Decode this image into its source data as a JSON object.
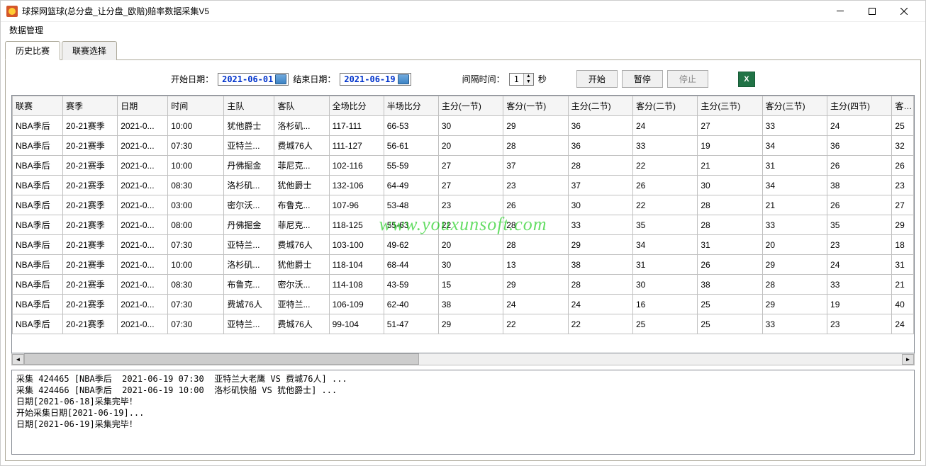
{
  "window": {
    "title": "球探网篮球(总分盘_让分盘_欧赔)赔率数据采集V5"
  },
  "menu": {
    "item1": "数据管理"
  },
  "tabs": {
    "history": "历史比赛",
    "league": "联赛选择"
  },
  "controls": {
    "start_date_label": "开始日期：",
    "start_date": "2021-06-01",
    "end_date_label": "结束日期：",
    "end_date": "2021-06-19",
    "interval_label": "间隔时间：",
    "interval_value": "1",
    "interval_unit": "秒",
    "btn_start": "开始",
    "btn_pause": "暂停",
    "btn_stop": "停止",
    "excel_icon": "X"
  },
  "table": {
    "headers": [
      "联赛",
      "赛季",
      "日期",
      "时间",
      "主队",
      "客队",
      "全场比分",
      "半场比分",
      "主分(一节)",
      "客分(一节)",
      "主分(二节)",
      "客分(二节)",
      "主分(三节)",
      "客分(三节)",
      "主分(四节)",
      "客分"
    ],
    "rows": [
      [
        "NBA季后",
        "20-21赛季",
        "2021-0...",
        "10:00",
        "犹他爵士",
        "洛杉矶...",
        "117-111",
        "66-53",
        "30",
        "29",
        "36",
        "24",
        "27",
        "33",
        "24",
        "25"
      ],
      [
        "NBA季后",
        "20-21赛季",
        "2021-0...",
        "07:30",
        "亚特兰...",
        "费城76人",
        "111-127",
        "56-61",
        "20",
        "28",
        "36",
        "33",
        "19",
        "34",
        "36",
        "32"
      ],
      [
        "NBA季后",
        "20-21赛季",
        "2021-0...",
        "10:00",
        "丹佛掘金",
        "菲尼克...",
        "102-116",
        "55-59",
        "27",
        "37",
        "28",
        "22",
        "21",
        "31",
        "26",
        "26"
      ],
      [
        "NBA季后",
        "20-21赛季",
        "2021-0...",
        "08:30",
        "洛杉矶...",
        "犹他爵士",
        "132-106",
        "64-49",
        "27",
        "23",
        "37",
        "26",
        "30",
        "34",
        "38",
        "23"
      ],
      [
        "NBA季后",
        "20-21赛季",
        "2021-0...",
        "03:00",
        "密尔沃...",
        "布鲁克...",
        "107-96",
        "53-48",
        "23",
        "26",
        "30",
        "22",
        "28",
        "21",
        "26",
        "27"
      ],
      [
        "NBA季后",
        "20-21赛季",
        "2021-0...",
        "08:00",
        "丹佛掘金",
        "菲尼克...",
        "118-125",
        "55-63",
        "22",
        "28",
        "33",
        "35",
        "28",
        "33",
        "35",
        "29"
      ],
      [
        "NBA季后",
        "20-21赛季",
        "2021-0...",
        "07:30",
        "亚特兰...",
        "费城76人",
        "103-100",
        "49-62",
        "20",
        "28",
        "29",
        "34",
        "31",
        "20",
        "23",
        "18"
      ],
      [
        "NBA季后",
        "20-21赛季",
        "2021-0...",
        "10:00",
        "洛杉矶...",
        "犹他爵士",
        "118-104",
        "68-44",
        "30",
        "13",
        "38",
        "31",
        "26",
        "29",
        "24",
        "31"
      ],
      [
        "NBA季后",
        "20-21赛季",
        "2021-0...",
        "08:30",
        "布鲁克...",
        "密尔沃...",
        "114-108",
        "43-59",
        "15",
        "29",
        "28",
        "30",
        "38",
        "28",
        "33",
        "21"
      ],
      [
        "NBA季后",
        "20-21赛季",
        "2021-0...",
        "07:30",
        "费城76人",
        "亚特兰...",
        "106-109",
        "62-40",
        "38",
        "24",
        "24",
        "16",
        "25",
        "29",
        "19",
        "40"
      ],
      [
        "NBA季后",
        "20-21赛季",
        "2021-0...",
        "07:30",
        "亚特兰...",
        "费城76人",
        "99-104",
        "51-47",
        "29",
        "22",
        "22",
        "25",
        "25",
        "33",
        "23",
        "24"
      ]
    ]
  },
  "log": {
    "lines": [
      "采集 424465 [NBA季后  2021-06-19 07:30  亚特兰大老鹰 VS 费城76人] ...",
      "采集 424466 [NBA季后  2021-06-19 10:00  洛杉矶快船 VS 犹他爵士] ...",
      "日期[2021-06-18]采集完毕！",
      "开始采集日期[2021-06-19]...",
      "日期[2021-06-19]采集完毕！"
    ]
  },
  "watermark": "www.youxunsoft.com"
}
